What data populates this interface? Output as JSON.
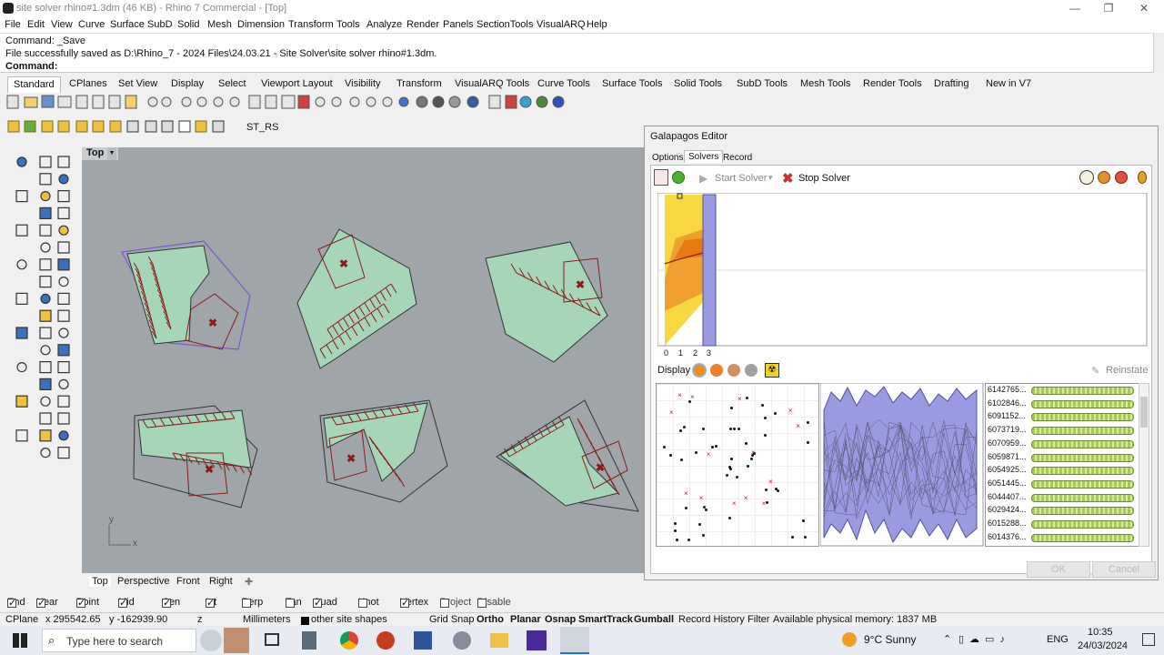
{
  "window": {
    "title": "site solver rhino#1.3dm (46 KB) - Rhino 7 Commercial - [Top]"
  },
  "menu": [
    "File",
    "Edit",
    "View",
    "Curve",
    "Surface",
    "SubD",
    "Solid",
    "Mesh",
    "Dimension",
    "Transform",
    "Tools",
    "Analyze",
    "Render",
    "Panels",
    "SectionTools",
    "VisualARQ",
    "Help"
  ],
  "command": {
    "line1": "Command: _Save",
    "line2": "File successfully saved as D:\\Rhino_7 - 2024 Files\\24.03.21 - Site Solver\\site solver rhino#1.3dm.",
    "prompt": "Command:"
  },
  "toolbar_tabs": [
    "Standard",
    "CPlanes",
    "Set View",
    "Display",
    "Select",
    "Viewport Layout",
    "Visibility",
    "Transform",
    "VisualARQ Tools",
    "Curve Tools",
    "Surface Tools",
    "Solid Tools",
    "SubD Tools",
    "Mesh Tools",
    "Render Tools",
    "Drafting",
    "New in V7"
  ],
  "plugin_label": "ST_RS",
  "viewport": {
    "name": "Top",
    "axis_y": "y",
    "axis_x": "x"
  },
  "viewport_tabs": [
    "Top",
    "Perspective",
    "Front",
    "Right"
  ],
  "galapagos": {
    "title": "Galapagos Editor",
    "tabs": [
      "Options",
      "Solvers",
      "Record"
    ],
    "start_solver": "Start Solver",
    "stop_solver": "Stop Solver",
    "xaxis": [
      "0",
      "1",
      "2",
      "3"
    ],
    "display_label": "Display",
    "reinstate": "Reinstate",
    "fitness": [
      "6142765...",
      "6102846...",
      "6091152...",
      "6073719...",
      "6070959...",
      "6059871...",
      "6054925...",
      "6051445...",
      "6044407...",
      "6029424...",
      "6015288...",
      "6014376..."
    ],
    "ok": "OK",
    "cancel": "Cancel"
  },
  "osnaps": [
    {
      "label": "End",
      "checked": true
    },
    {
      "label": "Near",
      "checked": true
    },
    {
      "label": "Point",
      "checked": true
    },
    {
      "label": "Mid",
      "checked": true
    },
    {
      "label": "Cen",
      "checked": true
    },
    {
      "label": "Int",
      "checked": true
    },
    {
      "label": "Perp",
      "checked": false
    },
    {
      "label": "Tan",
      "checked": false
    },
    {
      "label": "Quad",
      "checked": true
    },
    {
      "label": "Knot",
      "checked": false
    },
    {
      "label": "Vertex",
      "checked": true
    },
    {
      "label": "Project",
      "checked": false
    },
    {
      "label": "Disable",
      "checked": false
    }
  ],
  "status": {
    "cplane": "CPlane",
    "x": "x 295542.65",
    "y": "y -162939.90",
    "z": "z",
    "units": "Millimeters",
    "layer": "other site shapes",
    "grid_snap": "Grid Snap",
    "ortho": "Ortho",
    "planar": "Planar",
    "osnap": "Osnap",
    "smarttrack": "SmartTrack",
    "gumball": "Gumball",
    "record_history": "Record History",
    "filter": "Filter",
    "memory": "Available physical memory: 1837 MB"
  },
  "taskbar": {
    "search_placeholder": "Type here to search",
    "weather": "9°C  Sunny",
    "lang": "ENG",
    "time": "10:35",
    "date": "24/03/2024"
  },
  "colors": {
    "site_fill": "#a6d6b8",
    "outline": "#333333",
    "parking": "#8b1a1a",
    "selected": "#7a5ad0",
    "galapagos_bar": "#f0b020",
    "population": "#9a9ae0"
  }
}
